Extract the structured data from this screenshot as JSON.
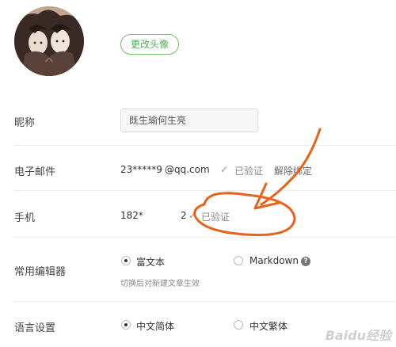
{
  "avatar": {
    "button": "更改头像"
  },
  "nickname": {
    "label": "昵称",
    "value": "既生瑜何生亮"
  },
  "email": {
    "label": "电子邮件",
    "masked": "23*****9",
    "domain": "@qq.com",
    "status": "已验证",
    "unbind": "解除绑定"
  },
  "phone": {
    "label": "手机",
    "prefix": "182*",
    "suffix": "2",
    "status": "已验证"
  },
  "editor": {
    "label": "常用编辑器",
    "option1": "富文本",
    "option2": "Markdown",
    "selected": "富文本",
    "hint": "切换后对新建文章生效"
  },
  "language": {
    "label": "语言设置",
    "option1": "中文简体",
    "option2": "中文繁体",
    "selected": "中文简体"
  },
  "annotation": {
    "color": "#e8621a"
  },
  "watermark": "Baidu经验"
}
